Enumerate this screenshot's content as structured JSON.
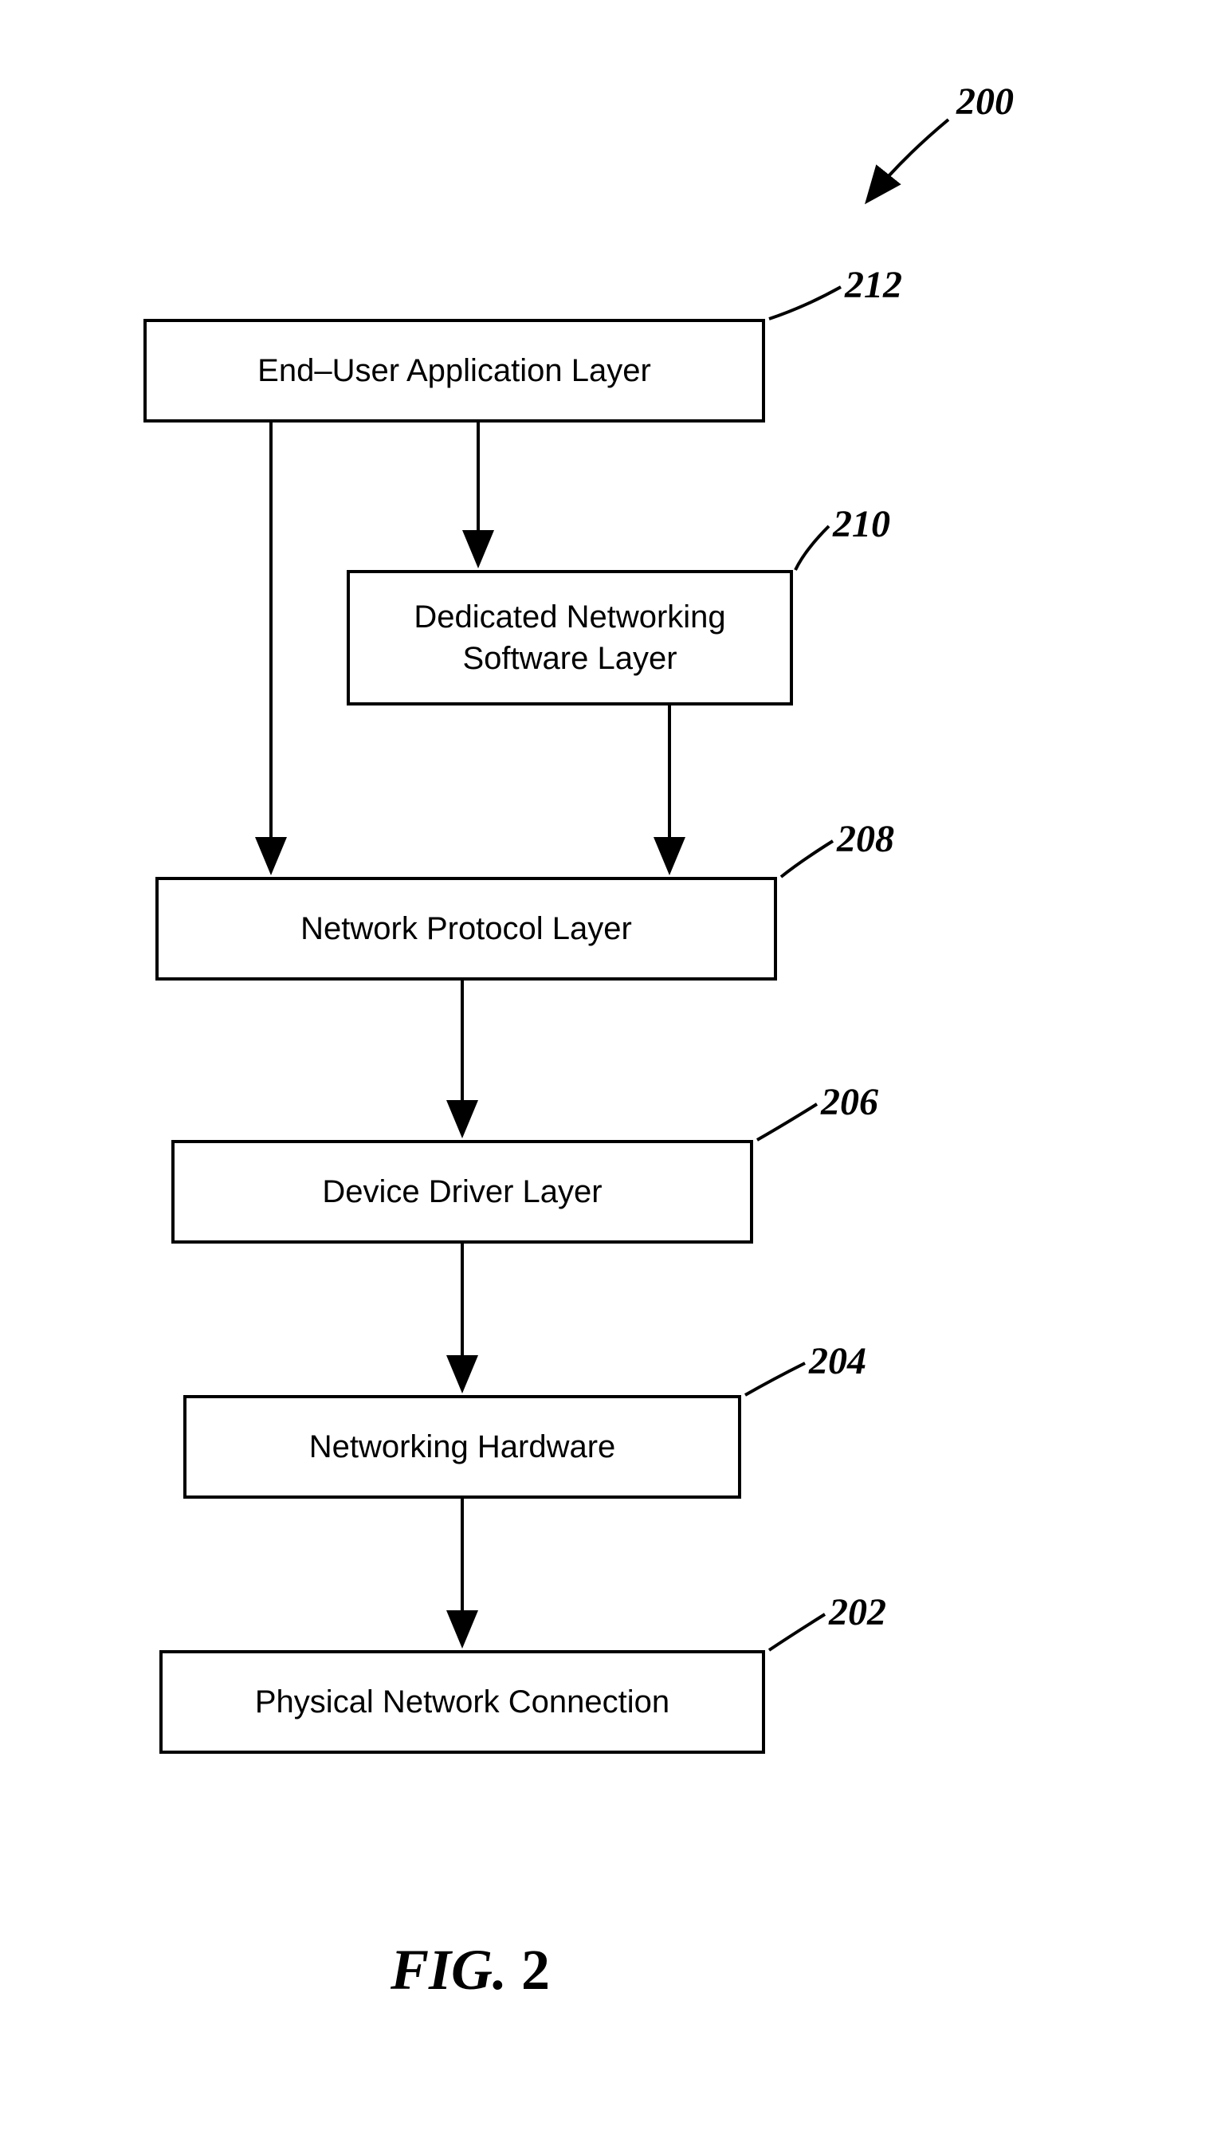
{
  "figure_ref": "200",
  "figure_label_prefix": "FIG.",
  "figure_label_num": "2",
  "boxes": {
    "layer212": {
      "label": "End–User Application Layer",
      "ref": "212"
    },
    "layer210": {
      "label": "Dedicated Networking\nSoftware Layer",
      "ref": "210"
    },
    "layer208": {
      "label": "Network Protocol Layer",
      "ref": "208"
    },
    "layer206": {
      "label": "Device Driver Layer",
      "ref": "206"
    },
    "layer204": {
      "label": "Networking Hardware",
      "ref": "204"
    },
    "layer202": {
      "label": "Physical Network Connection",
      "ref": "202"
    }
  }
}
